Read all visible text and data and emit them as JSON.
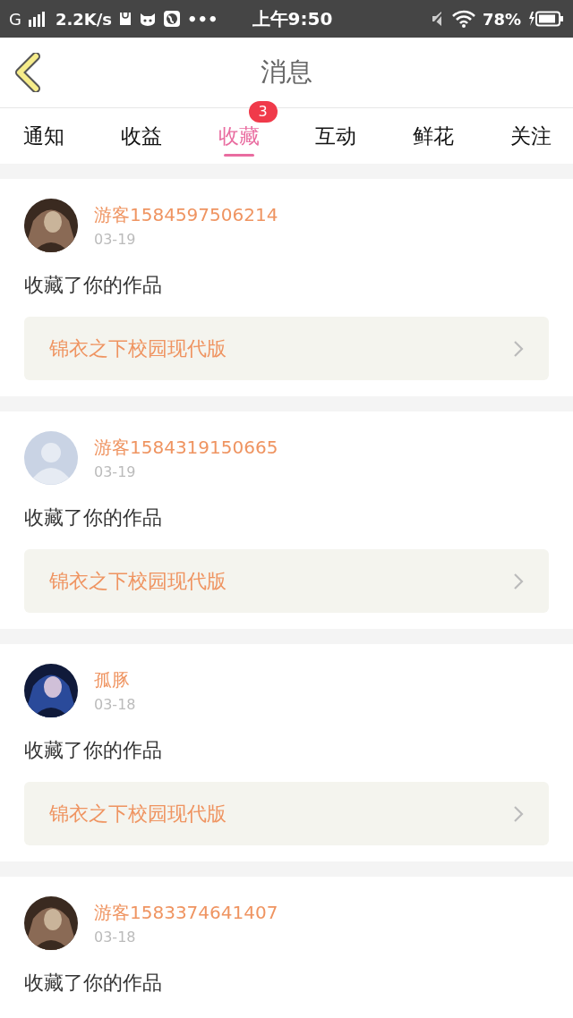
{
  "status_bar": {
    "network": "G",
    "speed": "2.2K/s",
    "more": "•••",
    "time": "上午9:50",
    "battery": "78%"
  },
  "header": {
    "title": "消息"
  },
  "tabs": [
    {
      "label": "通知",
      "selected": false
    },
    {
      "label": "收益",
      "selected": false
    },
    {
      "label": "收藏",
      "selected": true,
      "badge": "3"
    },
    {
      "label": "互动",
      "selected": false
    },
    {
      "label": "鲜花",
      "selected": false
    },
    {
      "label": "关注",
      "selected": false
    }
  ],
  "messages": [
    {
      "user": "游客1584597506214",
      "kind": "picture",
      "date": "03-19",
      "text": "收藏了你的作品",
      "work": "锦衣之下校园现代版"
    },
    {
      "user": "游客1584319150665",
      "kind": "default",
      "date": "03-19",
      "text": "收藏了你的作品",
      "work": "锦衣之下校园现代版"
    },
    {
      "user": "孤豚",
      "kind": "picture",
      "date": "03-18",
      "text": "收藏了你的作品",
      "work": "锦衣之下校园现代版"
    },
    {
      "user": "游客1583374641407",
      "kind": "picture",
      "date": "03-18",
      "text": "收藏了你的作品"
    }
  ]
}
